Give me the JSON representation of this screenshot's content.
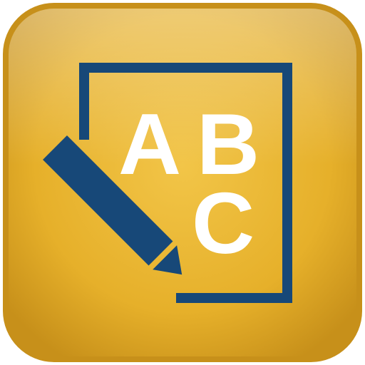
{
  "icon": {
    "letters": {
      "first": "A",
      "second": "B",
      "third": "C"
    },
    "colors": {
      "tile_light": "#f2c548",
      "tile_mid": "#e6b02a",
      "tile_dark": "#c7901a",
      "tile_border": "#d4a01e",
      "navy": "#174878",
      "letter": "#ffffff"
    }
  }
}
